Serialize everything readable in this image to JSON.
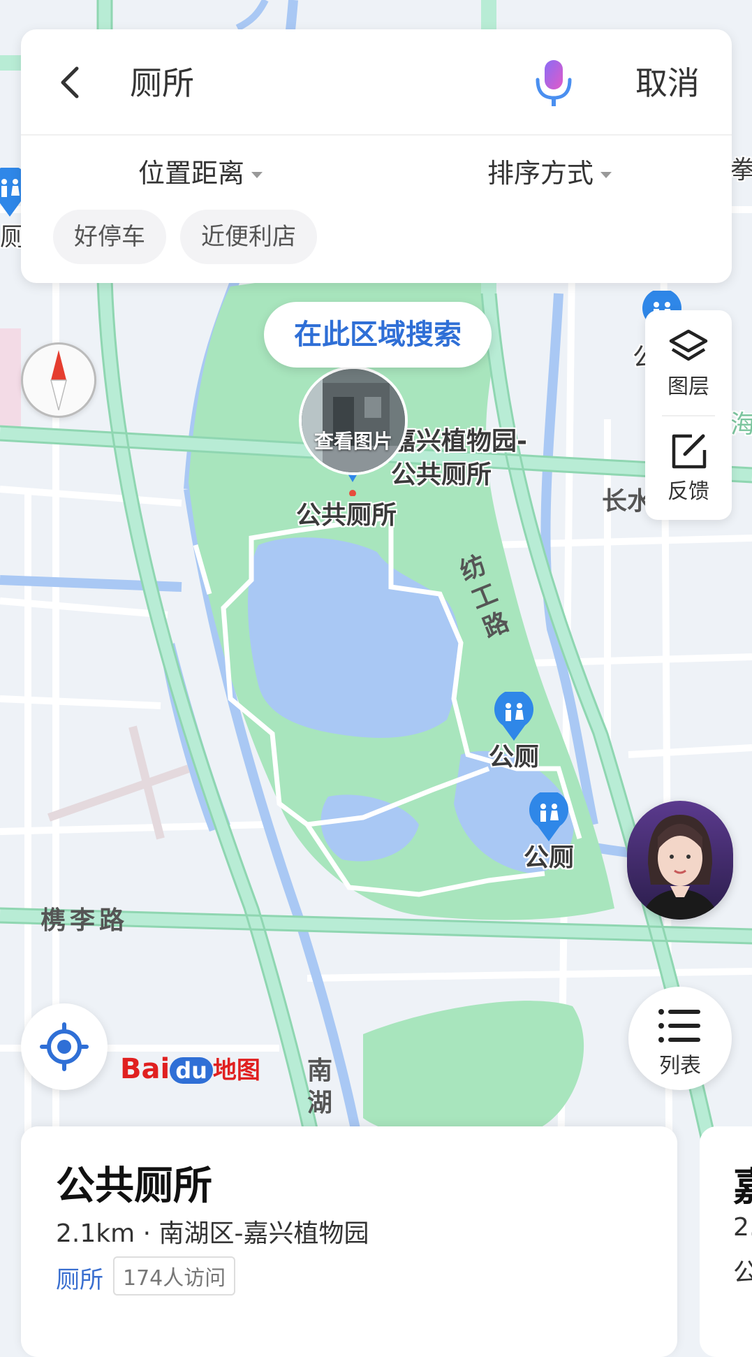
{
  "search": {
    "query": "厕所",
    "cancel_label": "取消",
    "filters": [
      "位置距离",
      "排序方式"
    ],
    "chips": [
      "好停车",
      "近便利店"
    ]
  },
  "map": {
    "search_area_label": "在此区域搜索",
    "photo_caption": "查看图片",
    "poi_main_label": "公共厕所",
    "poi_secondary_label_line1": "嘉兴植物园-",
    "poi_secondary_label_line2": "公共厕所",
    "toilet_label": "公厕",
    "road_labels": [
      "纺工路",
      "槜李路",
      "南湖",
      "长水"
    ],
    "edge_labels": [
      "厕",
      "拳",
      "公",
      "海"
    ],
    "logo": {
      "bai": "Bai",
      "du": "du",
      "ditu": "地图"
    }
  },
  "side_panel": {
    "layers_label": "图层",
    "feedback_label": "反馈"
  },
  "list_label": "列表",
  "result": {
    "title": "公共厕所",
    "meta": "2.1km · 南湖区-嘉兴植物园",
    "category": "厕所",
    "visits": "174人访问"
  },
  "next_result": {
    "title_partial": "嘉",
    "meta_partial": "2.",
    "line_partial": "公"
  },
  "colors": {
    "accent": "#2f6fd6",
    "park_green": "#a8e5bd",
    "water_blue": "#a9c8f4",
    "road_green": "#b8ecd5",
    "map_bg": "#eef2f7",
    "marker_blue": "#2f87e8"
  }
}
